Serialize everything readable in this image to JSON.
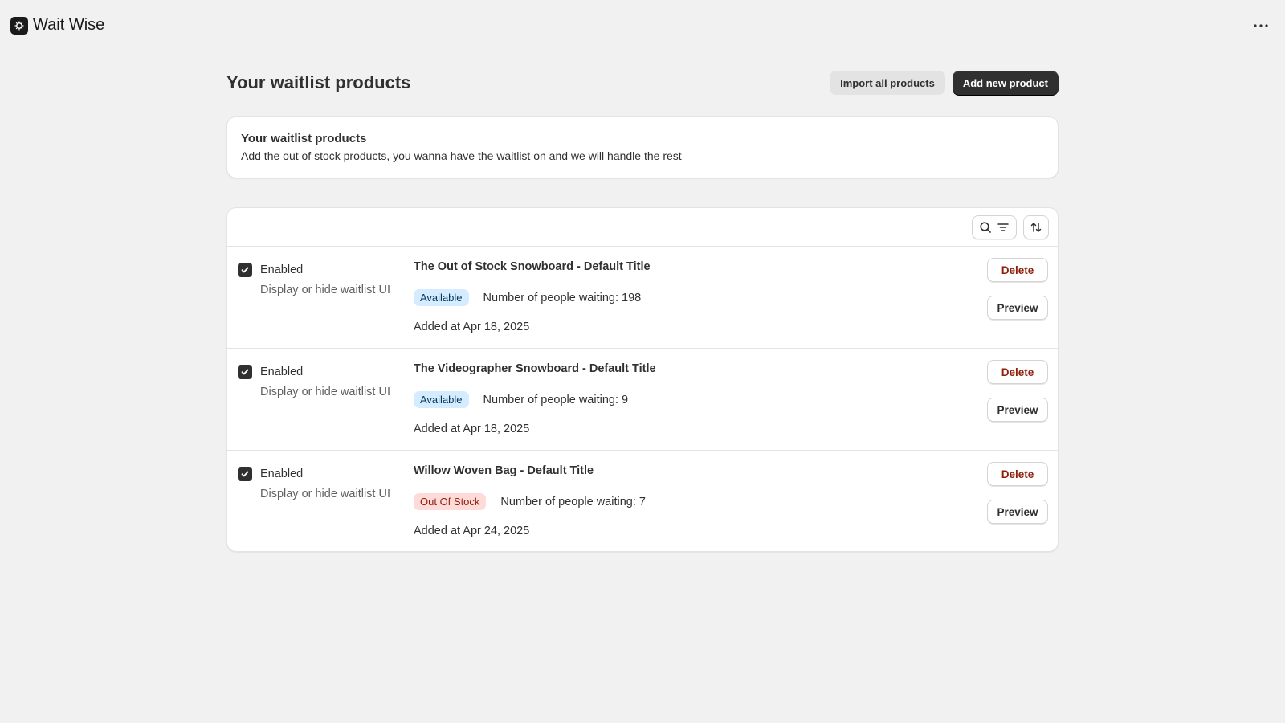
{
  "app": {
    "title": "Wait Wise",
    "logo_icon": "app-logo-icon",
    "more_icon": "more-horizontal-icon"
  },
  "page": {
    "title": "Your waitlist products",
    "import_label": "Import all products",
    "add_label": "Add new product"
  },
  "intro": {
    "title": "Your waitlist products",
    "description": "Add the out of stock products, you wanna have the waitlist on and we will handle the rest"
  },
  "toolbar": {
    "search_filter_icons": [
      "search-icon",
      "filter-icon"
    ],
    "sort_icon": "sort-icon"
  },
  "products": [
    {
      "enabled": true,
      "enabled_label": "Enabled",
      "help": "Display or hide waitlist UI",
      "name": "The Out of Stock Snowboard - Default Title",
      "status": "Available",
      "waiting": "Number of people waiting: 198",
      "added": "Added at Apr 18, 2025",
      "delete_label": "Delete",
      "preview_label": "Preview"
    },
    {
      "enabled": true,
      "enabled_label": "Enabled",
      "help": "Display or hide waitlist UI",
      "name": "The Videographer Snowboard - Default Title",
      "status": "Available",
      "waiting": "Number of people waiting: 9",
      "added": "Added at Apr 18, 2025",
      "delete_label": "Delete",
      "preview_label": "Preview"
    },
    {
      "enabled": true,
      "enabled_label": "Enabled",
      "help": "Display or hide waitlist UI",
      "name": "Willow Woven Bag - Default Title",
      "status": "Out Of Stock",
      "waiting": "Number of people waiting: 7",
      "added": "Added at Apr 24, 2025",
      "delete_label": "Delete",
      "preview_label": "Preview"
    }
  ],
  "colors": {
    "background": "#f1f1f1",
    "primary_button": "#303030",
    "badge_available_bg": "#d5ebff",
    "badge_out_of_stock_bg": "#fedad9",
    "delete_text": "#8e1f0b"
  }
}
